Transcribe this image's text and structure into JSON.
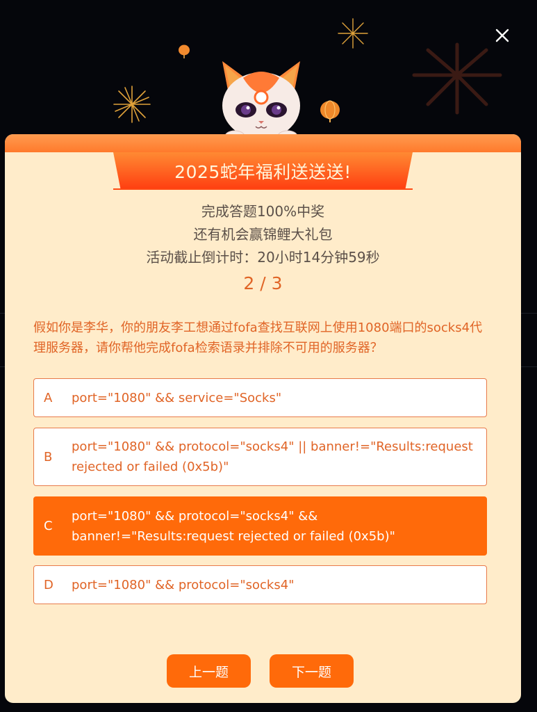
{
  "dialog": {
    "close_icon": "close-icon",
    "title": "2025蛇年福利送送送!",
    "promo_lines": [
      "完成答题100%中奖",
      "还有机会赢锦鲤大礼包",
      "活动截止倒计时：20小时14分钟59秒"
    ],
    "progress": "2 / 3",
    "question": "假如你是李华，你的朋友李工想通过fofa查找互联网上使用1080端口的socks4代理服务器，请你帮他完成fofa检索语录并排除不可用的服务器？",
    "options": [
      {
        "letter": "A",
        "text": "port=\"1080\" && service=\"Socks\"",
        "selected": false
      },
      {
        "letter": "B",
        "text": "port=\"1080\" && protocol=\"socks4\" || banner!=\"Results:request rejected or failed (0x5b)\"",
        "selected": false
      },
      {
        "letter": "C",
        "text": "port=\"1080\" && protocol=\"socks4\" && banner!=\"Results:request rejected or failed (0x5b)\"",
        "selected": true
      },
      {
        "letter": "D",
        "text": "port=\"1080\" && protocol=\"socks4\"",
        "selected": false
      }
    ],
    "prev_label": "上一题",
    "next_label": "下一题"
  },
  "colors": {
    "backdrop": "#05060b",
    "panel": "#ffecca",
    "accent": "#ff6a0a",
    "text_orange": "#e06426",
    "text_gray": "#5b5049"
  },
  "icons": {
    "mascot": "fox-mascot-icon",
    "fireworks": "firework-icon",
    "lantern": "lantern-icon"
  }
}
